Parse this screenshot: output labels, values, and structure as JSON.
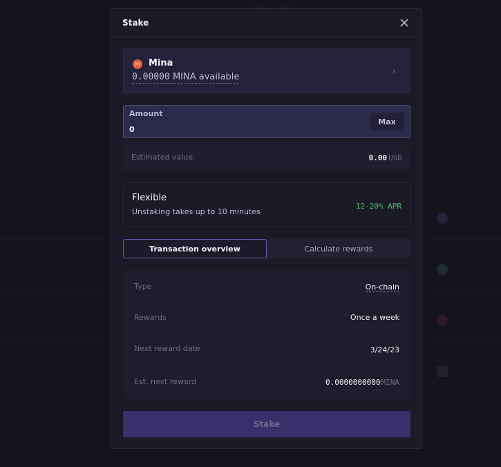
{
  "modal": {
    "title": "Stake",
    "close_icon": "close-icon"
  },
  "asset": {
    "icon": "mina-coin-icon",
    "icon_color": "#e25a35",
    "name": "Mina",
    "available_amount": "0.00000",
    "available_suffix": "MINA available",
    "chevron_icon": "chevron-right-icon"
  },
  "amount": {
    "label": "Amount",
    "value": "0",
    "max_label": "Max"
  },
  "estimated": {
    "label": "Estimated value",
    "value": "0.00",
    "unit": "USD"
  },
  "plan": {
    "title": "Flexible",
    "subtitle": "Unstaking takes up to 10 minutes",
    "apr": "12-20% APR",
    "apr_color": "#3fbf6f"
  },
  "tabs": [
    {
      "label": "Transaction overview",
      "active": true
    },
    {
      "label": "Calculate rewards",
      "active": false
    }
  ],
  "overview": {
    "rows": [
      {
        "label": "Type",
        "value": "On-chain"
      },
      {
        "label": "Rewards",
        "value": "Once a week"
      },
      {
        "label": "Next reward date",
        "value": "3/24/23"
      },
      {
        "label": "Est. next reward",
        "value": "0.0000000000",
        "unit": "MINA"
      }
    ]
  },
  "stake_button": {
    "label": "Stake",
    "disabled": true
  },
  "colors": {
    "accent": "#6c4fb5",
    "background": "#15141f",
    "modal_bg": "#1b1a27",
    "button_bg": "#3a2f6a"
  }
}
